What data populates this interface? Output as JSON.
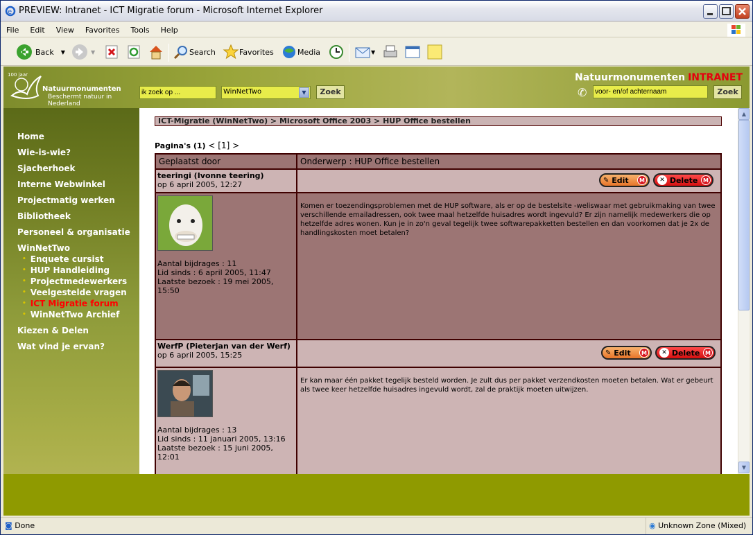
{
  "window": {
    "title": "PREVIEW: Intranet - ICT Migratie forum - Microsoft Internet Explorer"
  },
  "menu": [
    "File",
    "Edit",
    "View",
    "Favorites",
    "Tools",
    "Help"
  ],
  "toolbar": {
    "back": "Back",
    "search": "Search",
    "favorites": "Favorites",
    "media": "Media"
  },
  "header": {
    "logo_top": "100 jaar",
    "logo_name": "Natuurmonumenten",
    "logo_sub": "Beschermt natuur in Nederland",
    "search_value": "ik zoek op ...",
    "select_value": "WinNetTwo",
    "search_button": "Zoek",
    "brand": "Natuurmonumenten",
    "brand_intranet": "INTRANET",
    "name_value": "voor- en/of achternaam",
    "name_button": "Zoek"
  },
  "sidebar": {
    "items": [
      "Home",
      "Wie-is-wie?",
      "Sjacherhoek",
      "Interne Webwinkel",
      "Projectmatig werken",
      "Bibliotheek",
      "Personeel & organisatie",
      "WinNetTwo"
    ],
    "subitems": [
      "Enquete cursist",
      "HUP Handleiding",
      "Projectmedewerkers",
      "Veelgestelde vragen",
      "ICT Migratie forum",
      "WinNetTwo Archief"
    ],
    "active_subitem": "ICT Migratie forum",
    "after": [
      "Kiezen & Delen",
      "Wat vind je ervan?"
    ]
  },
  "forum": {
    "breadcrumb": "ICT-Migratie (WinNetTwo) > Microsoft Office 2003 > HUP Office bestellen",
    "pages_label": "Pagina's (1)",
    "pages_nav": "< [1] >",
    "col_author": "Geplaatst door",
    "col_subject": "Onderwerp : HUP Office bestellen",
    "edit_label": "Edit",
    "delete_label": "Delete",
    "m_label": "M",
    "posts": [
      {
        "author": "teeringi (Ivonne teering)",
        "date": "op 6 april 2005, 12:27",
        "bijdrages": "Aantal bijdrages : 11",
        "lid_sinds": "Lid sinds : 6 april 2005, 11:47",
        "bezoek": "Laatste bezoek : 19 mei 2005, 15:50",
        "message": "Komen er toezendingsproblemen met de HUP software, als er op de bestelsite -weliswaar met gebruikmaking van twee verschillende emailadressen, ook twee maal hetzelfde huisadres wordt ingevuld? Er zijn namelijk medewerkers die op hetzelfde adres wonen. Kun je in zo'n geval tegelijk twee softwarepakketten bestellen en dan voorkomen dat je 2x de handlingskosten moet betalen?"
      },
      {
        "author": "WerfP (Pieterjan van der Werf)",
        "date": "op 6 april 2005, 15:25",
        "bijdrages": "Aantal bijdrages : 13",
        "lid_sinds": "Lid sinds : 11 januari 2005, 13:16",
        "bezoek": "Laatste bezoek : 15 juni 2005, 12:01",
        "message": "Er kan maar één pakket tegelijk besteld worden. Je zult dus per pakket verzendkosten moeten betalen. Wat er gebeurt als twee keer hetzelfde huisadres ingevuld wordt, zal de praktijk moeten uitwijzen."
      }
    ]
  },
  "status": {
    "left": "Done",
    "zone": "Unknown Zone (Mixed)"
  }
}
